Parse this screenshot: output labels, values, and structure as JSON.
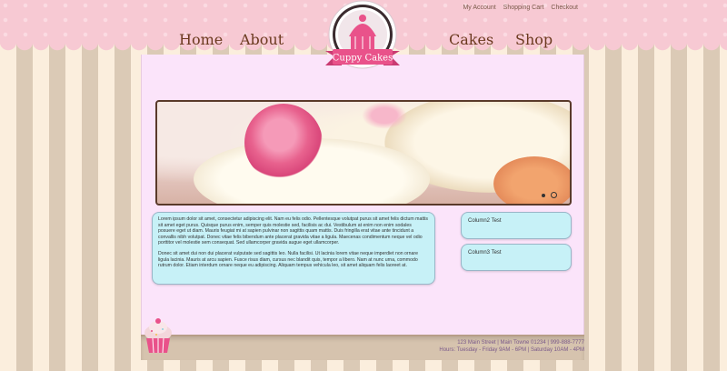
{
  "account_nav": [
    "My Account",
    "Shopping Cart",
    "Checkout"
  ],
  "main_nav": {
    "home": "Home",
    "about": "About",
    "cakes": "Cakes",
    "shop": "Shop"
  },
  "logo": {
    "text": "Cuppy Cakes"
  },
  "slider": {
    "slide_count": 2,
    "active_slide": 2
  },
  "content": {
    "paragraph1": "Lorem ipsum dolor sit amet, consectetur adipiscing elit. Nam eu felis odio. Pellentesque volutpat purus sit amet felis dictum mattis sit amet eget purus. Quisque purus enim, semper quis molestie sed, facilisis ac dui. Vestibulum at enim non enim sodales posuere eget ut diam. Mauris feugiat mi at sapien pulvinar non sagittis quam mattis. Duis fringilla erat vitae ante tincidunt a convallis nibh volutpat. Donec vitae felis bibendum ante placerat gravida vitae a ligula. Maecenas condimentum neque vel odio porttitor vel molestie sem consequat. Sed ullamcorper gravida augue eget ullamcorper.",
    "paragraph2": "Donec sit amet dui non dui placerat vulputate sed sagittis leo. Nulla facilisi. Ut lacinia lorem vitae neque imperdiet non ornare ligula lacinia. Mauris at arcu sapien. Fusce risus diam, cursus nec blandit quis, tempor a libero. Nam at nunc urna, commodo rutrum dolor. Etiam interdum ornare neque eu adipiscing. Aliquam tempus vehicula leo, sit amet aliquam felis laoreet at."
  },
  "column2": "Column2 Test",
  "column3": "Column3 Test",
  "footer": {
    "address": "123 Main Street | Main Towne 01234 | 999-888-7777",
    "hours": "Hours: Tuesday - Friday 9AM - 6PM | Saturday 10AM - 4PM"
  },
  "colors": {
    "background_stripe_light": "#fbeedd",
    "background_stripe_dark": "#dbcab6",
    "top_band_pink": "#f7c9d3",
    "panel": "#fbe4fa",
    "box": "#c7f1f7",
    "nav_text": "#6b3a1f",
    "logo_ribbon": "#e9528a"
  }
}
